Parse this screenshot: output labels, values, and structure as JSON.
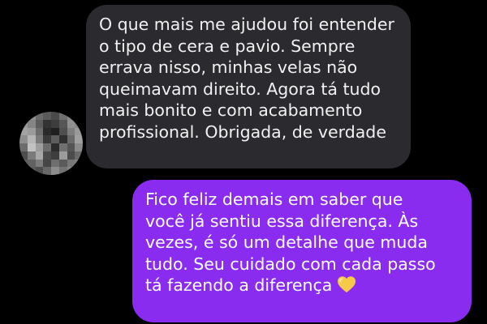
{
  "conversation": {
    "incoming": {
      "lines": [
        "O que mais me ajudou foi entender",
        "o tipo de cera e pavio. Sempre",
        "errava nisso, minhas velas não",
        "queimavam direito. Agora tá tudo",
        "mais bonito e com acabamento",
        "profissional. Obrigada, de verdade"
      ]
    },
    "outgoing": {
      "lines": [
        "Fico feliz demais em saber que",
        "você já sentiu essa diferença. Às",
        "vezes, é só um detalhe que muda",
        "tudo. Seu cuidado com cada passo",
        "tá fazendo a diferença"
      ],
      "emoji": "yellow-heart-icon"
    }
  },
  "colors": {
    "background": "#000000",
    "incoming_bubble": "#2b2b2f",
    "outgoing_bubble": "#8a2cf0",
    "heart": "#f7c948"
  },
  "avatar": {
    "blurred": true
  }
}
